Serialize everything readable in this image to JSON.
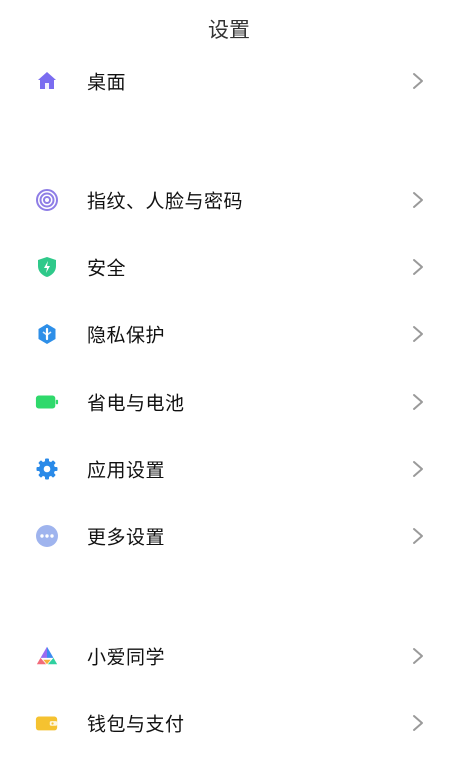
{
  "header": {
    "title": "设置"
  },
  "groups": [
    {
      "items": [
        {
          "label": "桌面",
          "icon": "home-icon"
        }
      ]
    },
    {
      "items": [
        {
          "label": "指纹、人脸与密码",
          "icon": "fingerprint-icon"
        },
        {
          "label": "安全",
          "icon": "shield-icon"
        },
        {
          "label": "隐私保护",
          "icon": "privacy-icon"
        },
        {
          "label": "省电与电池",
          "icon": "battery-icon"
        },
        {
          "label": "应用设置",
          "icon": "gear-icon"
        },
        {
          "label": "更多设置",
          "icon": "more-icon"
        }
      ]
    },
    {
      "items": [
        {
          "label": "小爱同学",
          "icon": "xiaoai-icon"
        },
        {
          "label": "钱包与支付",
          "icon": "wallet-icon"
        }
      ]
    }
  ],
  "colors": {
    "home": "#7a6cf0",
    "fingerprint": "#8e7de6",
    "shield": "#2fc98a",
    "privacy": "#2e8fe8",
    "battery": "#2fd96b",
    "gear": "#2a8ae8",
    "more": "#9fb4ee",
    "wallet": "#f5c230",
    "chevron": "#9a9a9a"
  }
}
